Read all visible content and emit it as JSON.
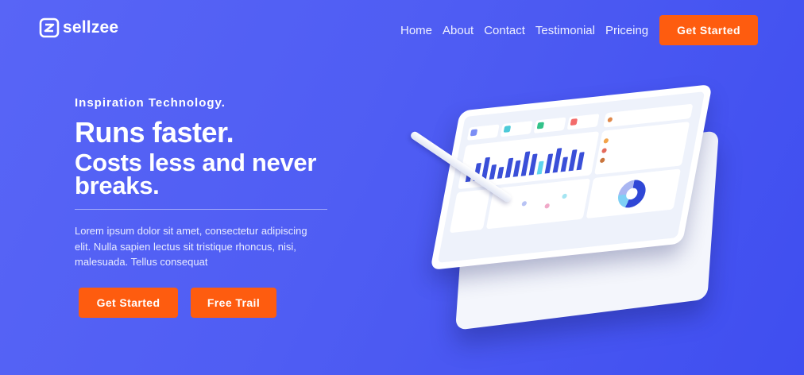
{
  "brand": {
    "name": "sellzee"
  },
  "nav": {
    "items": [
      "Home",
      "About",
      "Contact",
      "Testimonial",
      "Priceing"
    ],
    "cta_label": "Get Started"
  },
  "hero": {
    "eyebrow": "Inspiration Technology.",
    "headline": "Runs faster.",
    "subheadline": "Costs less and never breaks.",
    "description": "Lorem ipsum dolor sit amet, consectetur adipiscing elit. Nulla sapien lectus sit tristique rhoncus, nisi, malesuada. Tellus consequat",
    "primary_button": "Get Started",
    "secondary_button": "Free Trail"
  },
  "colors": {
    "background": "#4f5df3",
    "accent": "#fe5c0f",
    "text": "#ffffff"
  },
  "illustration": {
    "icon": "tablet-dashboard-illustration"
  }
}
